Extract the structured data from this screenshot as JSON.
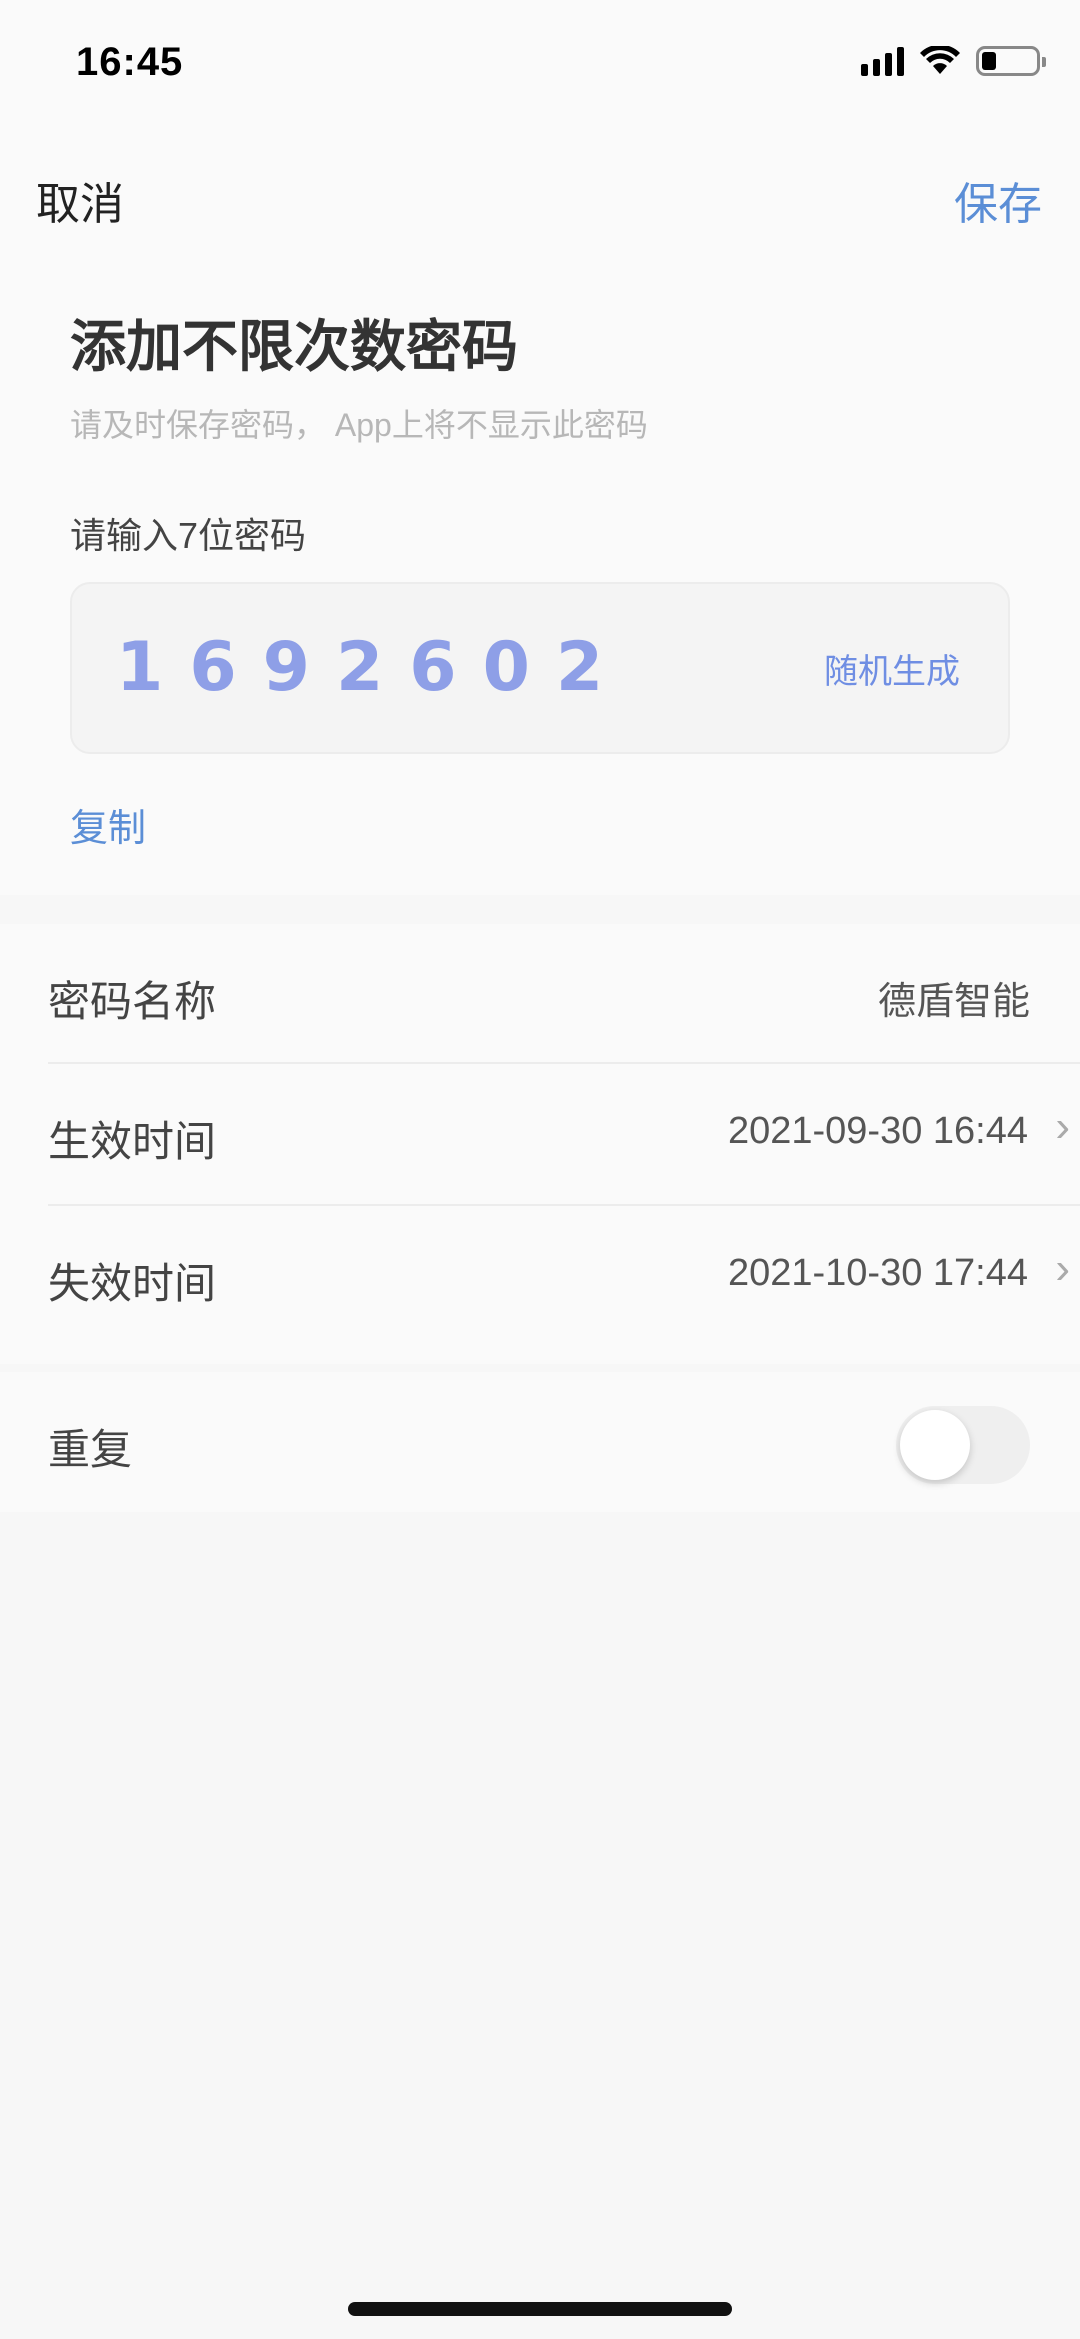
{
  "status_bar": {
    "time": "16:45"
  },
  "nav": {
    "cancel_label": "取消",
    "save_label": "保存"
  },
  "header": {
    "title": "添加不限次数密码",
    "subtitle": "请及时保存密码， App上将不显示此密码"
  },
  "password": {
    "label": "请输入7位密码",
    "value": "1692602",
    "random_label": "随机生成",
    "copy_label": "复制"
  },
  "settings": {
    "name": {
      "label": "密码名称",
      "value": "德盾智能"
    },
    "start_time": {
      "label": "生效时间",
      "value": "2021-09-30 16:44"
    },
    "end_time": {
      "label": "失效时间",
      "value": "2021-10-30 17:44"
    },
    "repeat": {
      "label": "重复",
      "enabled": false
    }
  },
  "colors": {
    "accent": "#5b8ed6",
    "code": "#8e9fe7"
  }
}
